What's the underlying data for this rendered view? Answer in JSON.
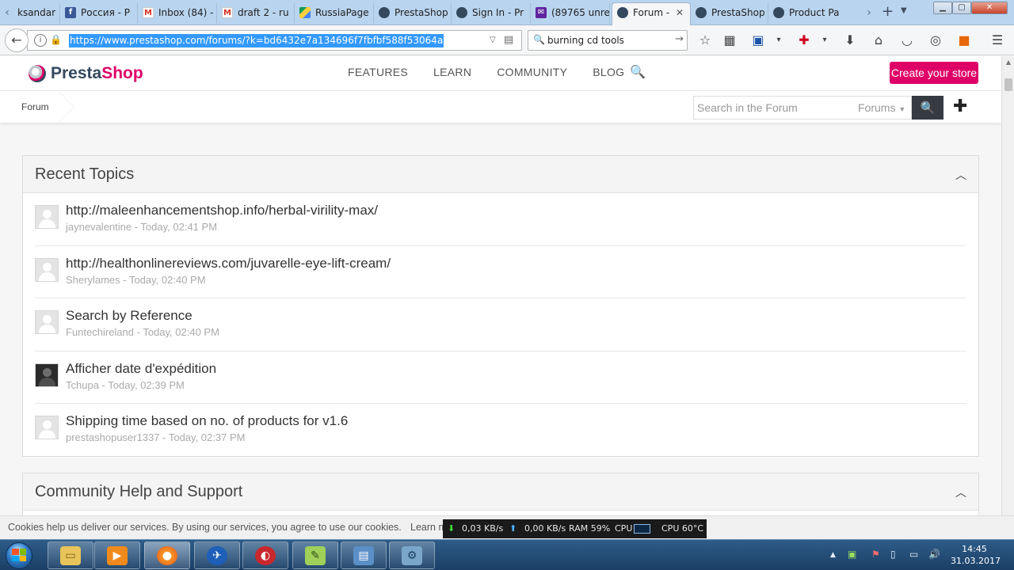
{
  "browser": {
    "tabs": [
      {
        "label": "ksandar",
        "icon": "generic-page-icon"
      },
      {
        "label": "Россия - P",
        "icon": "facebook-icon"
      },
      {
        "label": "Inbox (84) -",
        "icon": "gmail-icon"
      },
      {
        "label": "draft 2 - ru",
        "icon": "gmail-icon"
      },
      {
        "label": "RussiaPage",
        "icon": "google-drive-icon"
      },
      {
        "label": "PrestaShop",
        "icon": "prestashop-icon"
      },
      {
        "label": "Sign In - Pr",
        "icon": "prestashop-icon"
      },
      {
        "label": "(89765 unre",
        "icon": "yahoo-mail-icon"
      },
      {
        "label": "Forum -",
        "icon": "prestashop-icon",
        "active": true
      },
      {
        "label": "PrestaShop",
        "icon": "prestashop-icon"
      },
      {
        "label": "Product Pa",
        "icon": "prestashop-icon"
      }
    ],
    "url": "https://www.prestashop.com/forums/?k=bd6432e7a134696f7fbfbf588f53064a",
    "search_value": "burning cd tools"
  },
  "site": {
    "brand": {
      "part1": "Presta",
      "part2": "Shop"
    },
    "nav": [
      "FEATURES",
      "LEARN",
      "COMMUNITY",
      "BLOG"
    ],
    "cta": "Create your store",
    "brand_color": "#df0067"
  },
  "forumbar": {
    "breadcrumb": "Forum",
    "search_placeholder": "Search in the Forum",
    "search_scope": "Forums"
  },
  "recent": {
    "heading": "Recent Topics",
    "topics": [
      {
        "title": "http://maleenhancementshop.info/herbal-virility-max/",
        "meta": "jaynevalentine - Today, 02:41 PM"
      },
      {
        "title": "http://healthonlinereviews.com/juvarelle-eye-lift-cream/",
        "meta": "Sherylames - Today, 02:40 PM"
      },
      {
        "title": "Search by Reference",
        "meta": "Funtechireland - Today, 02:40 PM"
      },
      {
        "title": "Afficher date d'expédition",
        "meta": "Tchupa - Today, 02:39 PM"
      },
      {
        "title": "Shipping time based on no. of products for v1.6",
        "meta": "prestashopuser1337 - Today, 02:37 PM"
      }
    ]
  },
  "community": {
    "heading": "Community Help and Support"
  },
  "cookie": {
    "message": "Cookies help us deliver our services. By using our services, you agree to use our cookies.",
    "learn": "Learn m"
  },
  "monitor": {
    "down": "0,03 KB/s",
    "up": "0,00 KB/s",
    "ram": "RAM 59%",
    "cpu": "CPU",
    "cpu_temp": "CPU 60°C"
  },
  "taskbar": {
    "time": "14:45",
    "date": "31.03.2017"
  }
}
